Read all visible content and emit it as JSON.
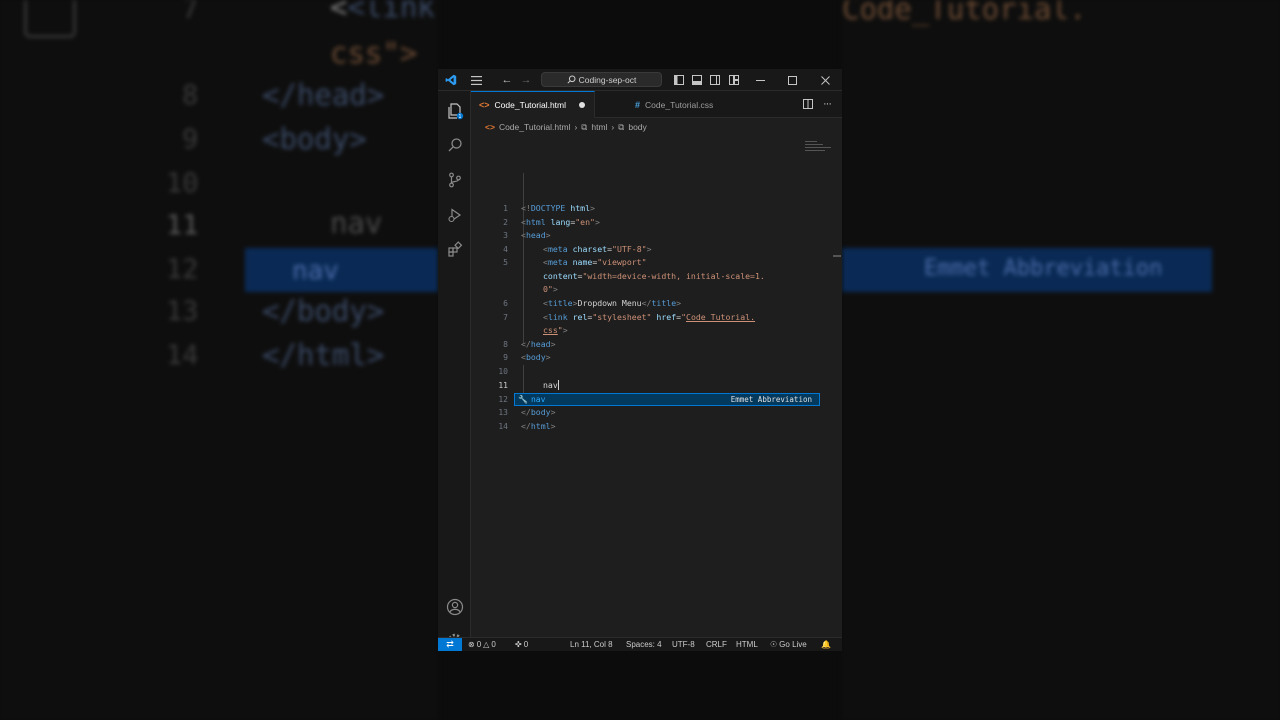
{
  "window": {
    "search_label": "Coding-sep-oct"
  },
  "tabs": [
    {
      "label": "Code_Tutorial.html",
      "icon": "html-file-icon",
      "modified": true,
      "active": true
    },
    {
      "label": "Code_Tutorial.css",
      "icon": "css-file-icon",
      "modified": false,
      "active": false
    }
  ],
  "breadcrumb": {
    "file": "Code_Tutorial.html",
    "items": [
      "html",
      "body"
    ]
  },
  "code_lines": [
    {
      "n": "1",
      "text": "<!DOCTYPE html>"
    },
    {
      "n": "2",
      "text": "<html lang=\"en\">"
    },
    {
      "n": "3",
      "text": "<head>"
    },
    {
      "n": "4",
      "text": "<meta charset=\"UTF-8\">"
    },
    {
      "n": "5",
      "text": "<meta name=\"viewport\""
    },
    {
      "n": "",
      "text": "content=\"width=device-width, initial-scale=1."
    },
    {
      "n": "",
      "text": "0\">"
    },
    {
      "n": "6",
      "text": "<title>Dropdown Menu</title>"
    },
    {
      "n": "7",
      "text": "<link rel=\"stylesheet\" href=\"Code_Tutorial."
    },
    {
      "n": "",
      "text": "css\">"
    },
    {
      "n": "8",
      "text": "</head>"
    },
    {
      "n": "9",
      "text": "<body>"
    },
    {
      "n": "10",
      "text": ""
    },
    {
      "n": "11",
      "text": "nav"
    },
    {
      "n": "12",
      "text": ""
    },
    {
      "n": "13",
      "text": "</body>"
    },
    {
      "n": "14",
      "text": "</html>"
    }
  ],
  "autocomplete": {
    "label": "nav",
    "detail": "Emmet Abbreviation",
    "icon": "wrench-icon"
  },
  "statusbar": {
    "errors": "0",
    "warnings": "0",
    "ports": "0",
    "position": "Ln 11, Col 8",
    "spaces": "Spaces: 4",
    "encoding": "UTF-8",
    "eol": "CRLF",
    "language": "HTML",
    "go_live": "Go Live"
  },
  "background_zoom": {
    "left_lines": [
      "<link",
      "css\">",
      "</head>",
      "<body>",
      "",
      "nav",
      "nav",
      "</body>",
      "</html>"
    ],
    "left_numbers": [
      "7",
      "8",
      "9",
      "10",
      "11",
      "12",
      "13",
      "14"
    ],
    "right_top": "Code_Tutorial.",
    "right_band": "Emmet Abbreviation"
  },
  "colors": {
    "accent": "#0078d4",
    "tag": "#569cd6",
    "string": "#ce9178",
    "attribute": "#9cdcfe",
    "suggest_bg": "#04395e"
  }
}
